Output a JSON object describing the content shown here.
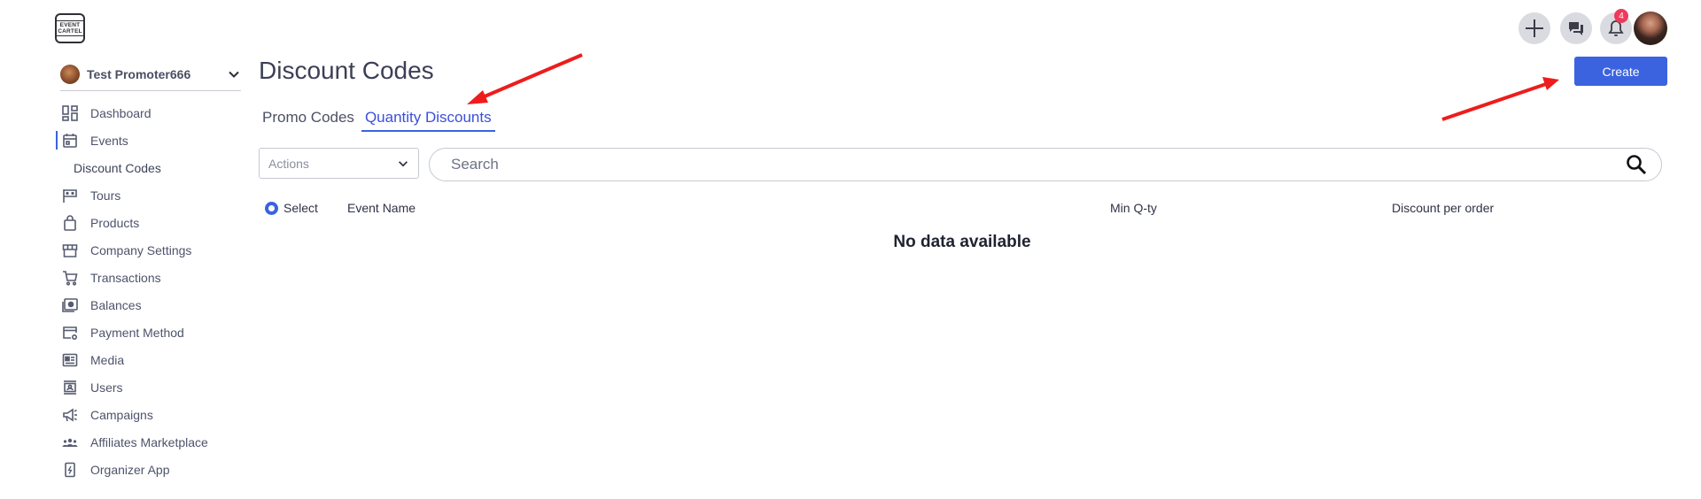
{
  "logo": {
    "line1": "EVENT",
    "line2": "CARTEL"
  },
  "account": {
    "name": "Test Promoter666"
  },
  "sidebar": {
    "items": [
      {
        "label": "Dashboard",
        "icon": "dashboard-icon"
      },
      {
        "label": "Events",
        "icon": "calendar-icon",
        "active": true
      },
      {
        "label": "Discount Codes",
        "sub": true
      },
      {
        "label": "Tours",
        "icon": "flag-icon"
      },
      {
        "label": "Products",
        "icon": "bag-icon"
      },
      {
        "label": "Company Settings",
        "icon": "store-icon"
      },
      {
        "label": "Transactions",
        "icon": "cart-icon"
      },
      {
        "label": "Balances",
        "icon": "wallet-icon"
      },
      {
        "label": "Payment Method",
        "icon": "card-settings-icon"
      },
      {
        "label": "Media",
        "icon": "media-icon"
      },
      {
        "label": "Users",
        "icon": "users-icon"
      },
      {
        "label": "Campaigns",
        "icon": "megaphone-icon"
      },
      {
        "label": "Affiliates Marketplace",
        "icon": "group-icon"
      },
      {
        "label": "Organizer App",
        "icon": "phone-icon"
      }
    ]
  },
  "page": {
    "title": "Discount Codes"
  },
  "tabs": [
    {
      "label": "Promo Codes",
      "active": false
    },
    {
      "label": "Quantity Discounts",
      "active": true
    }
  ],
  "actions": {
    "label": "Actions"
  },
  "search": {
    "placeholder": "Search"
  },
  "table": {
    "select_label": "Select",
    "columns": [
      "Event Name",
      "Min Q-ty",
      "Discount per order"
    ],
    "empty_text": "No data available"
  },
  "header": {
    "notifications_count": "4",
    "create_label": "Create"
  },
  "colors": {
    "accent": "#3b63e0",
    "badge": "#ee3b5b",
    "annotation_arrow": "#ee1c1c"
  }
}
